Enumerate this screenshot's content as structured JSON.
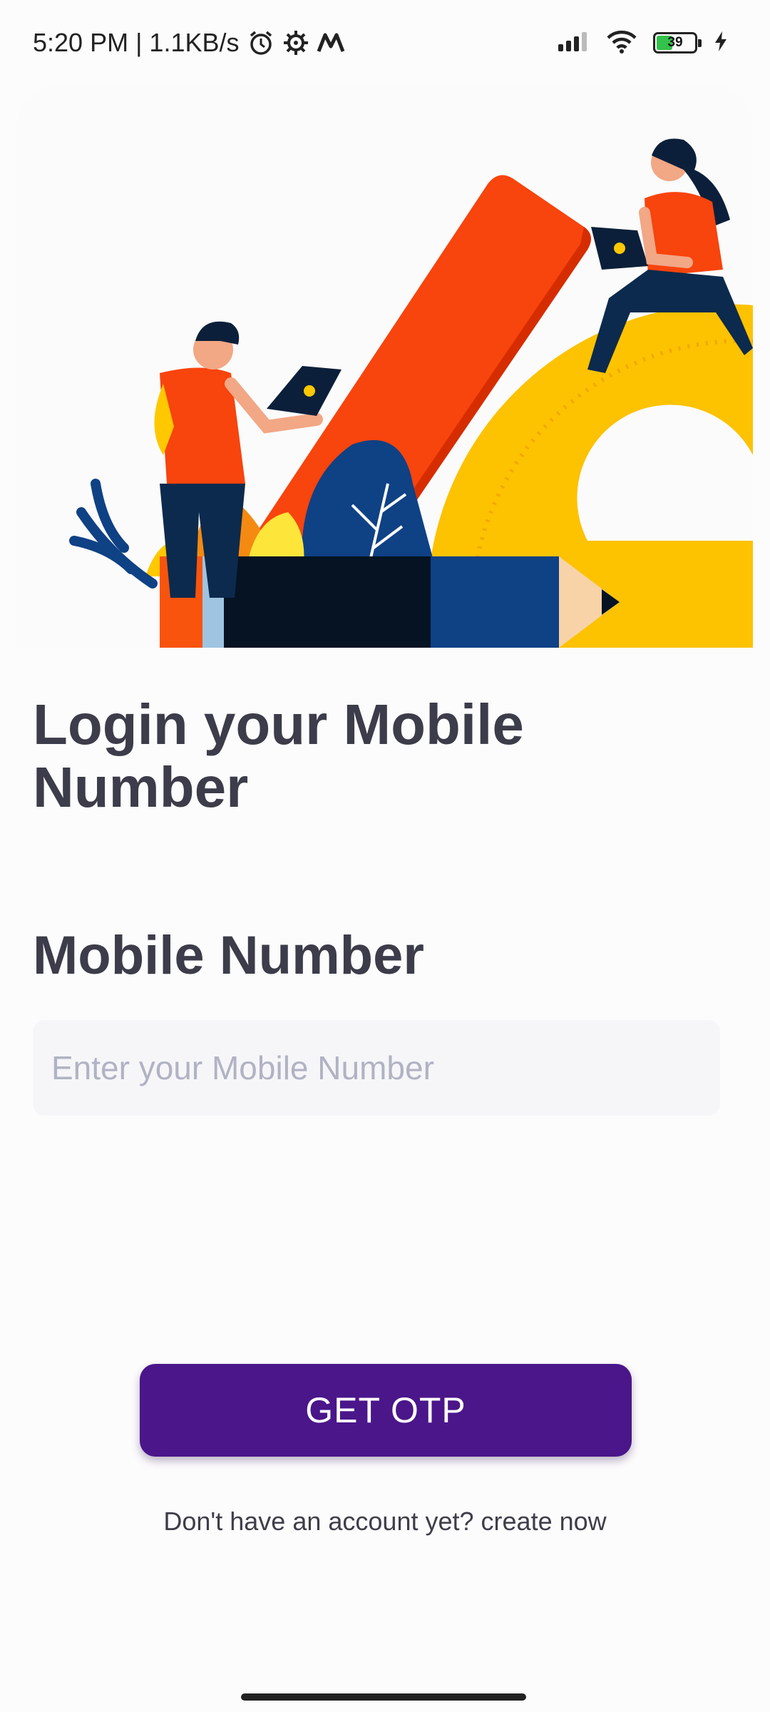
{
  "status_bar": {
    "time_speed": "5:20 PM | 1.1KB/s",
    "battery_level": "39",
    "icons": [
      "alarm-icon",
      "gear-icon",
      "m-logo-icon",
      "signal-icon",
      "wifi-icon",
      "battery-icon",
      "charging-icon"
    ]
  },
  "hero": {
    "image_name": "login-illustration"
  },
  "login": {
    "title": "Login your Mobile Number",
    "field_label": "Mobile Number",
    "placeholder": "Enter your Mobile Number",
    "value": "",
    "button_label": "GET OTP",
    "signup_prompt": "Don't have an account yet?",
    "signup_link": "create now"
  },
  "colors": {
    "accent": "#4a168a",
    "text": "#3c3c4a",
    "placeholder": "#b1b3c4",
    "input_bg": "#f6f6f8"
  }
}
